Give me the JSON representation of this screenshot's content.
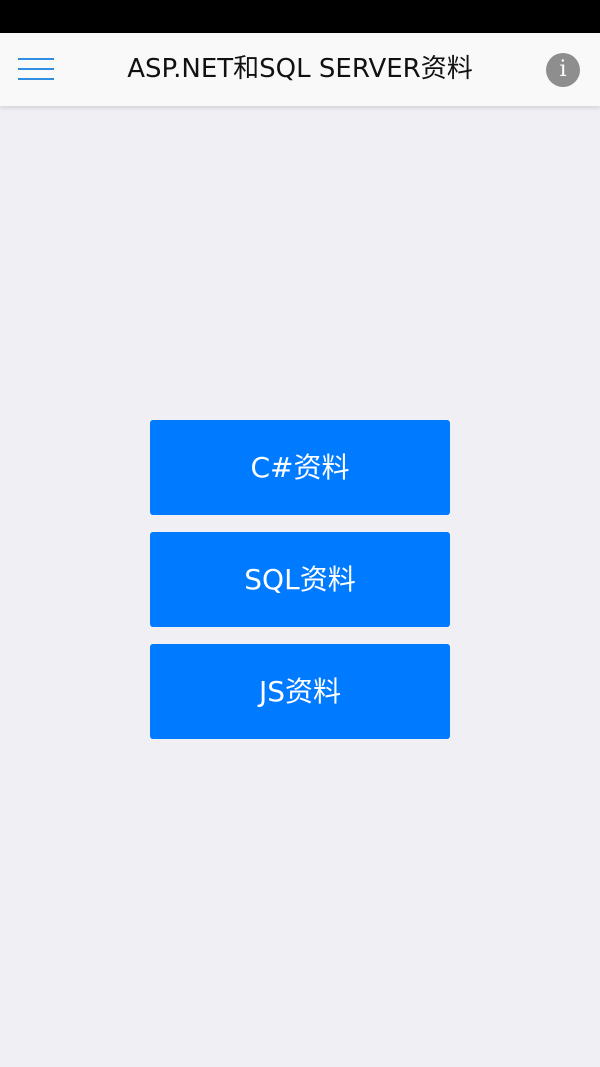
{
  "header": {
    "title": "ASP.NET和SQL SERVER资料",
    "menu_icon": "hamburger-menu-icon",
    "info_icon": "info-icon",
    "info_glyph": "i"
  },
  "buttons": [
    {
      "label": "C#资料"
    },
    {
      "label": "SQL资料"
    },
    {
      "label": "JS资料"
    }
  ],
  "colors": {
    "accent": "#007aff",
    "menu_icon": "#2f8ee0",
    "background": "#efeff4",
    "nav_background": "#f9f9f9"
  }
}
